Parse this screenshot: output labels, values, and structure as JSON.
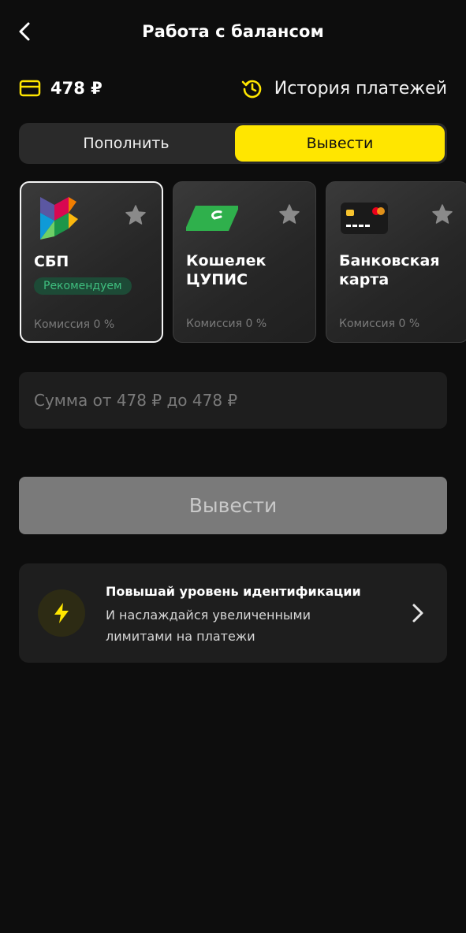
{
  "header": {
    "title": "Работа с балансом",
    "back_icon": "chevron-left-icon"
  },
  "balance": {
    "amount": "478 ₽",
    "wallet_icon": "credit-card-icon",
    "history_label": "История платежей",
    "history_icon": "history-icon"
  },
  "tabs": {
    "items": [
      {
        "label": "Пополнить",
        "active": false
      },
      {
        "label": "Вывести",
        "active": true
      }
    ]
  },
  "methods": [
    {
      "name": "СБП",
      "badge": "Рекомендуем",
      "commission": "Комиссия 0 %",
      "selected": true,
      "icon": "sbp-logo-icon"
    },
    {
      "name": "Кошелек ЦУПИС",
      "commission": "Комиссия 0 %",
      "selected": false,
      "icon": "cupis-logo-icon"
    },
    {
      "name": "Банковская карта",
      "commission": "Комиссия 0 %",
      "selected": false,
      "icon": "bank-card-icon"
    }
  ],
  "amount_input": {
    "placeholder": "Сумма от 478 ₽ до 478 ₽",
    "value": ""
  },
  "withdraw_button": {
    "label": "Вывести",
    "enabled": false
  },
  "promo": {
    "title": "Повышай уровень идентификации",
    "text": "И наслаждайся увеличенными лимитами на платежи",
    "icon": "lightning-icon",
    "chevron_icon": "chevron-right-icon"
  },
  "colors": {
    "background": "#0d0d0d",
    "accent": "#ffe600",
    "badge_bg": "#1d4a36",
    "badge_text": "#3fbf7f",
    "button_disabled": "#7a7a7a"
  }
}
